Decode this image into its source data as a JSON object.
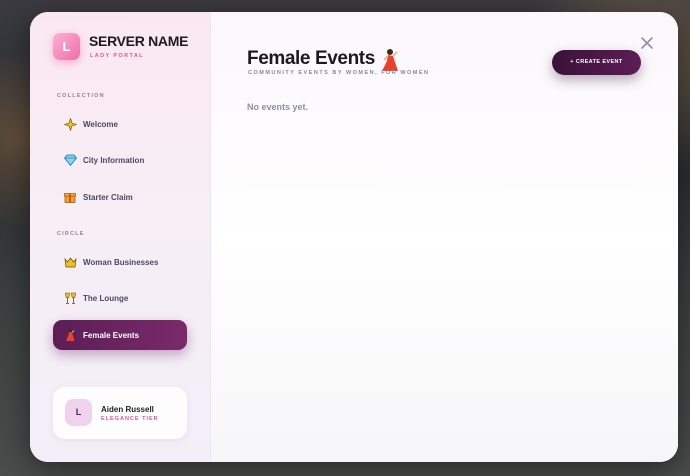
{
  "brand": {
    "logo_letter": "L",
    "title": "SERVER NAME",
    "subtitle": "LADY PORTAL"
  },
  "sidebar": {
    "sections": [
      {
        "label": "COLLECTION"
      },
      {
        "label": "CIRCLE"
      }
    ],
    "items": [
      {
        "label": "Welcome",
        "icon": "sparkle-icon"
      },
      {
        "label": "City Information",
        "icon": "diamond-icon"
      },
      {
        "label": "Starter Claim",
        "icon": "gift-icon"
      },
      {
        "label": "Woman Businesses",
        "icon": "crown-icon"
      },
      {
        "label": "The Lounge",
        "icon": "wine-glasses-icon"
      },
      {
        "label": "Female Events",
        "icon": "dancer-icon",
        "active": true
      }
    ]
  },
  "user": {
    "avatar_letter": "L",
    "name": "Aiden Russell",
    "tier": "ELEGANCE TIER"
  },
  "main": {
    "title": "Female Events",
    "subtitle": "COMMUNITY EVENTS BY WOMEN, FOR WOMEN",
    "create_label": "+ CREATE EVENT",
    "empty_text": "No events yet."
  },
  "colors": {
    "accent": "#5c1d56",
    "pink": "#e2559a",
    "muted": "#8a8598"
  }
}
